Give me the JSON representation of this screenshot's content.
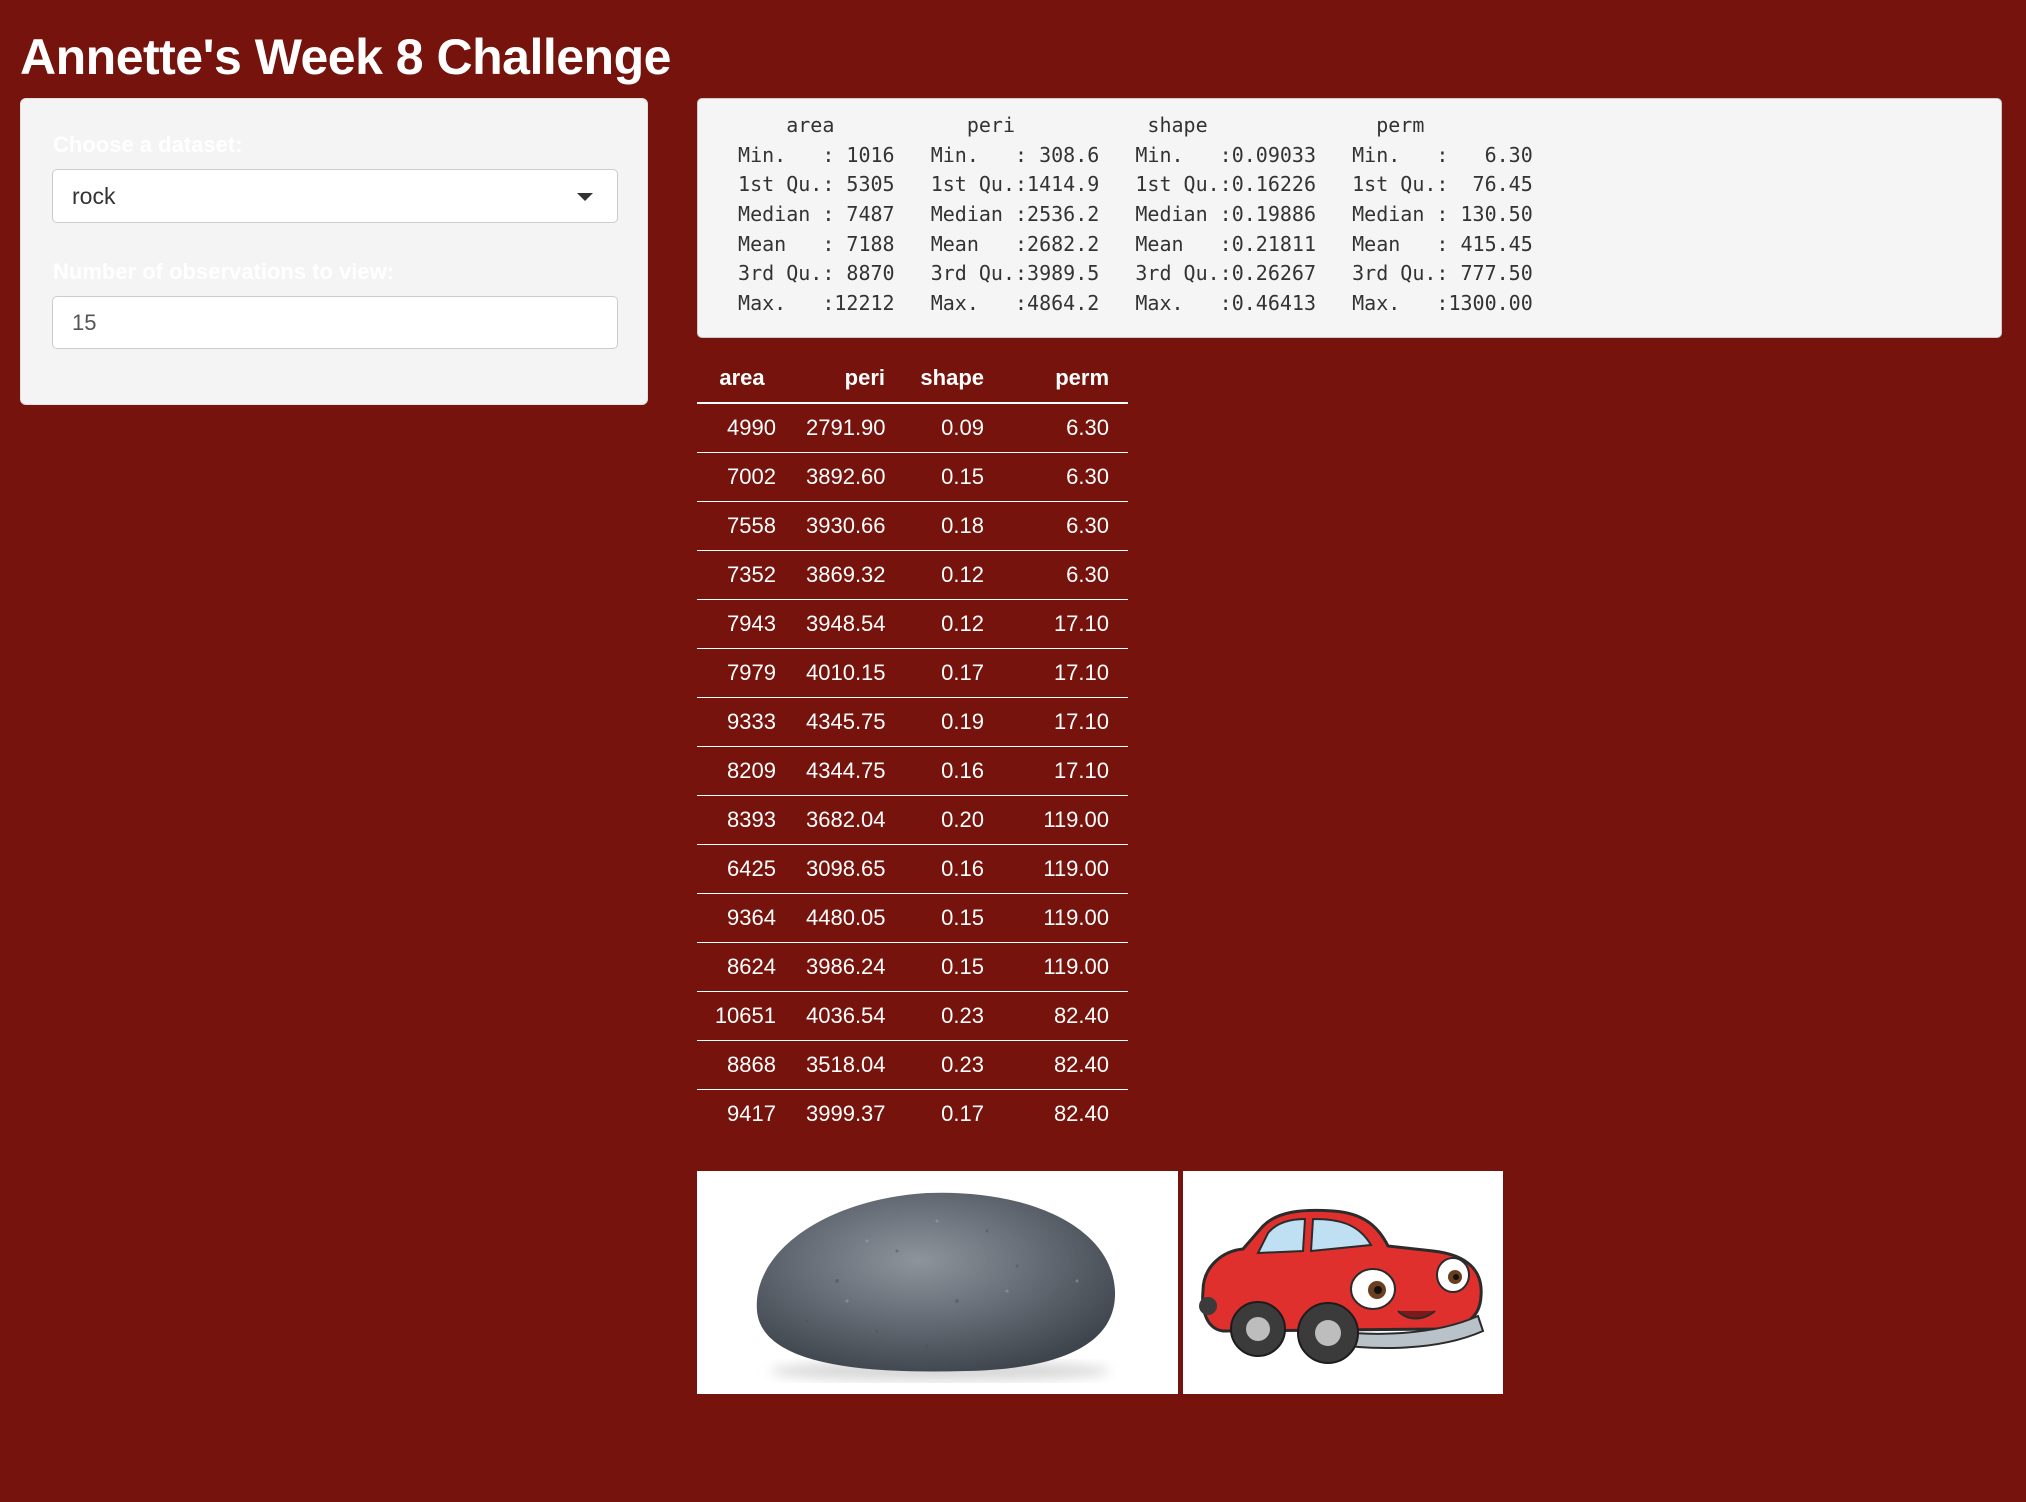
{
  "app": {
    "title": "Annette's Week 8 Challenge"
  },
  "sidebar": {
    "dataset_label": "Choose a dataset:",
    "dataset_value": "rock",
    "obs_label": "Number of observations to view:",
    "obs_value": "15"
  },
  "summary": {
    "lines": [
      "     area           peri           shape              perm       ",
      " Min.   : 1016   Min.   : 308.6   Min.   :0.09033   Min.   :   6.30  ",
      " 1st Qu.: 5305   1st Qu.:1414.9   1st Qu.:0.16226   1st Qu.:  76.45  ",
      " Median : 7487   Median :2536.2   Median :0.19886   Median : 130.50  ",
      " Mean   : 7188   Mean   :2682.2   Mean   :0.21811   Mean   : 415.45  ",
      " 3rd Qu.: 8870   3rd Qu.:3989.5   3rd Qu.:0.26267   3rd Qu.: 777.50  ",
      " Max.   :12212   Max.   :4864.2   Max.   :0.46413   Max.   :1300.00  "
    ]
  },
  "table": {
    "headers": [
      "area",
      "peri",
      "shape",
      "perm"
    ],
    "rows": [
      [
        "4990",
        "2791.90",
        "0.09",
        "6.30"
      ],
      [
        "7002",
        "3892.60",
        "0.15",
        "6.30"
      ],
      [
        "7558",
        "3930.66",
        "0.18",
        "6.30"
      ],
      [
        "7352",
        "3869.32",
        "0.12",
        "6.30"
      ],
      [
        "7943",
        "3948.54",
        "0.12",
        "17.10"
      ],
      [
        "7979",
        "4010.15",
        "0.17",
        "17.10"
      ],
      [
        "9333",
        "4345.75",
        "0.19",
        "17.10"
      ],
      [
        "8209",
        "4344.75",
        "0.16",
        "17.10"
      ],
      [
        "8393",
        "3682.04",
        "0.20",
        "119.00"
      ],
      [
        "6425",
        "3098.65",
        "0.16",
        "119.00"
      ],
      [
        "9364",
        "4480.05",
        "0.15",
        "119.00"
      ],
      [
        "8624",
        "3986.24",
        "0.15",
        "119.00"
      ],
      [
        "10651",
        "4036.54",
        "0.23",
        "82.40"
      ],
      [
        "8868",
        "3518.04",
        "0.23",
        "82.40"
      ],
      [
        "9417",
        "3999.37",
        "0.17",
        "82.40"
      ]
    ]
  },
  "images": {
    "rock": "rock-image",
    "car": "car-cartoon-image"
  },
  "colors": {
    "background": "#76130c",
    "panel": "#f4f4f4",
    "text_light": "#ffffff",
    "text_dark": "#333333"
  }
}
